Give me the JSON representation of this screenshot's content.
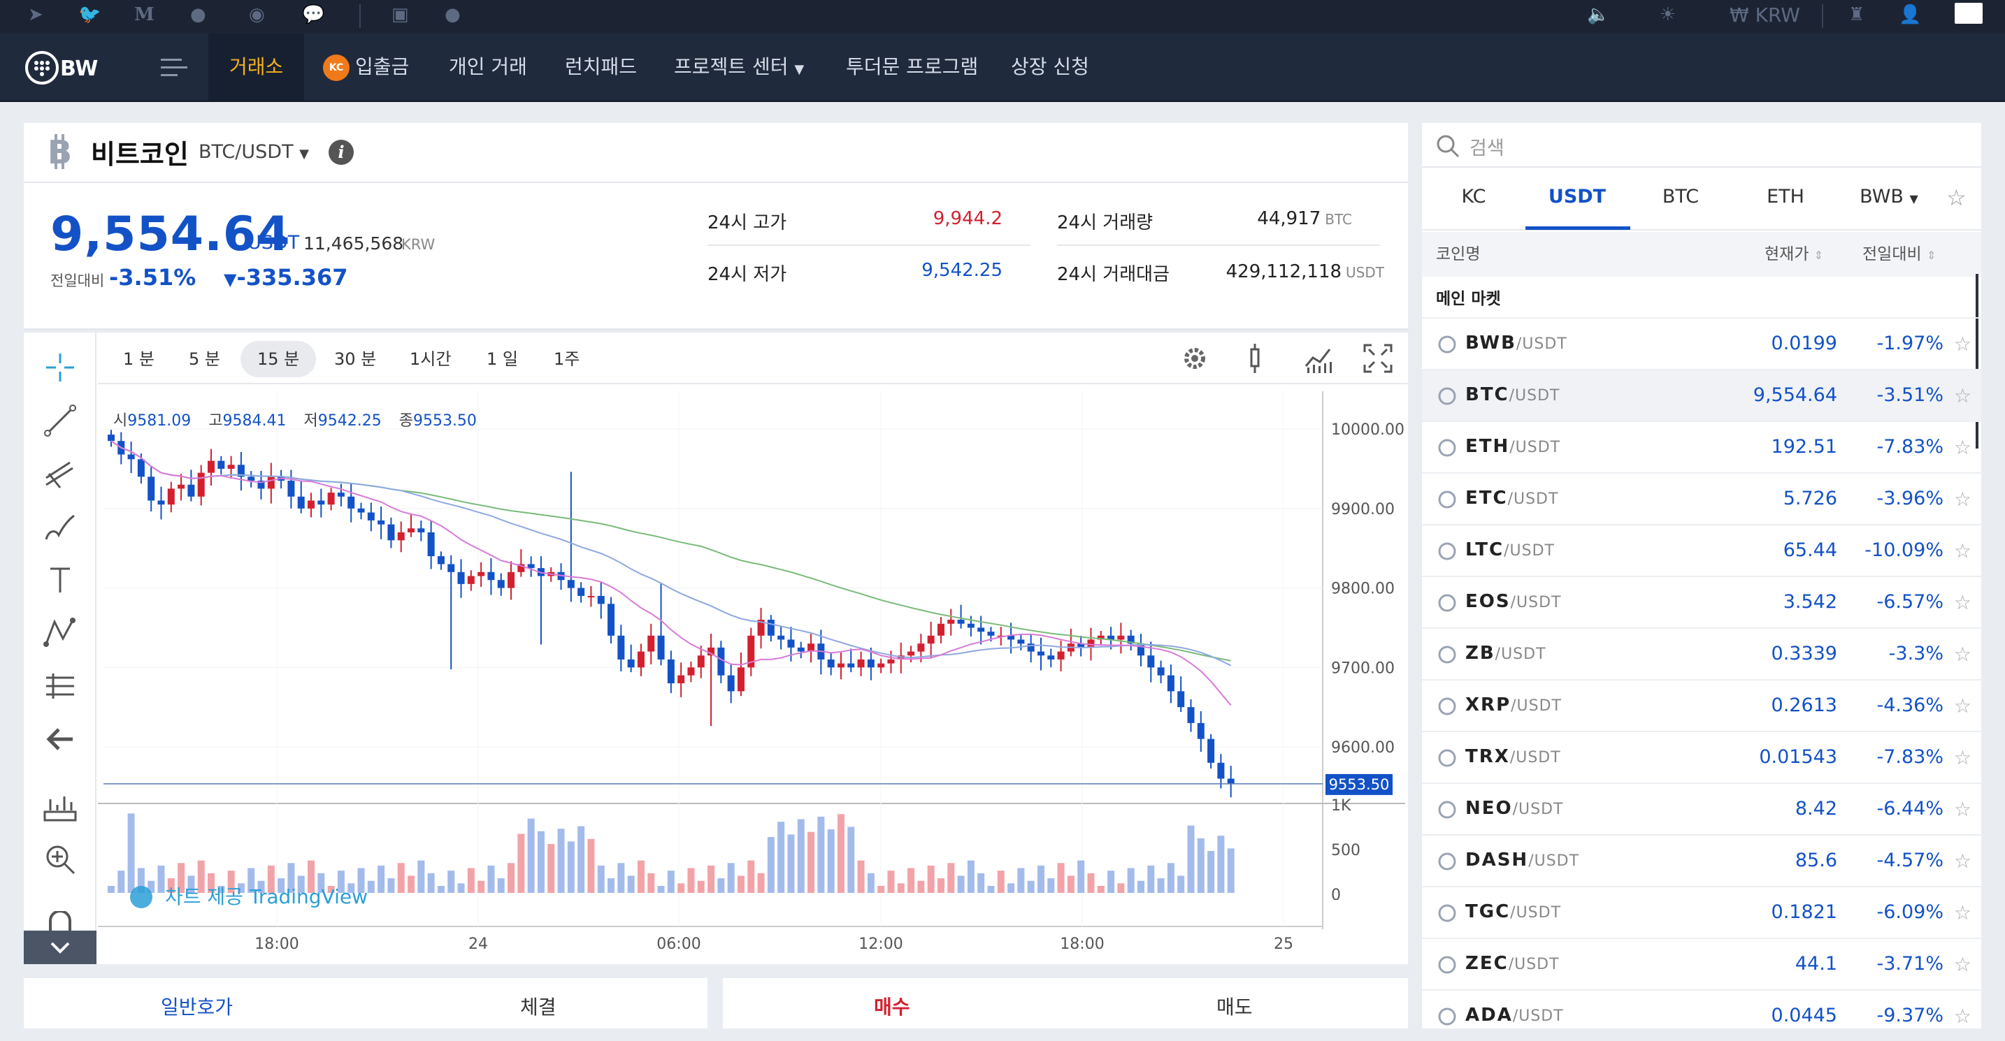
{
  "topbar": {
    "icons": [
      "telegram-icon",
      "twitter-icon",
      "medium-icon",
      "reddit-icon",
      "weibo-icon",
      "chat-icon",
      "android-icon",
      "apple-icon"
    ],
    "currency": "₩ KRW"
  },
  "nav": {
    "items": [
      {
        "label": "거래소",
        "active": true
      },
      {
        "label": "입출금",
        "badge": "KC"
      },
      {
        "label": "개인 거래"
      },
      {
        "label": "런치패드"
      },
      {
        "label": "프로젝트 센터"
      },
      {
        "label": "투더문 프로그램"
      },
      {
        "label": "상장 신청"
      }
    ]
  },
  "coin": {
    "name": "비트코인",
    "pair": "BTC/USDT"
  },
  "ticker": {
    "price": "9,554.64",
    "unit": "USDT",
    "krw": "11,465,568",
    "krw_unit": "KRW",
    "change_label": "전일대비",
    "change_pct": "-3.51%",
    "change_abs": "-335.367",
    "high_label": "24시 고가",
    "high": "9,944.2",
    "low_label": "24시 저가",
    "low": "9,542.25",
    "vol_label": "24시 거래량",
    "vol": "44,917",
    "vol_unit": "BTC",
    "amt_label": "24시 거래대금",
    "amt": "429,112,118",
    "amt_unit": "USDT"
  },
  "timeframes": [
    "1 분",
    "5 분",
    "15 분",
    "30 분",
    "1시간",
    "1 일",
    "1주"
  ],
  "active_timeframe": "15 분",
  "ohlc": {
    "o_label": "시",
    "o": "9581.09",
    "h_label": "고",
    "h": "9584.41",
    "l_label": "저",
    "l": "9542.25",
    "c_label": "종",
    "c": "9553.50"
  },
  "chart_data": {
    "type": "candlestick",
    "price_axis": [
      "10000.00",
      "9900.00",
      "9800.00",
      "9700.00",
      "9600.00"
    ],
    "volume_axis": [
      "1K",
      "500",
      "0"
    ],
    "time_axis": [
      "18:00",
      "24",
      "06:00",
      "12:00",
      "18:00",
      "25"
    ],
    "last_price": "9553.50",
    "watermark": "차트 제공 TradingView",
    "colors": {
      "up": "#d3202f",
      "down": "#1352c6",
      "ma1": "#7aba7a",
      "ma2": "#8fa8e0",
      "ma3": "#d87ad8"
    },
    "closes": [
      9985,
      9968,
      9962,
      9940,
      9910,
      9905,
      9925,
      9930,
      9915,
      9945,
      9960,
      9950,
      9955,
      9940,
      9935,
      9925,
      9940,
      9935,
      9915,
      9900,
      9910,
      9905,
      9920,
      9915,
      9900,
      9895,
      9885,
      9880,
      9860,
      9870,
      9875,
      9870,
      9840,
      9830,
      9820,
      9805,
      9815,
      9820,
      9810,
      9800,
      9820,
      9830,
      9825,
      9815,
      9820,
      9810,
      9800,
      9790,
      9790,
      9780,
      9740,
      9710,
      9700,
      9720,
      9740,
      9710,
      9680,
      9690,
      9700,
      9715,
      9725,
      9690,
      9670,
      9700,
      9740,
      9760,
      9740,
      9735,
      9725,
      9720,
      9730,
      9710,
      9700,
      9705,
      9700,
      9710,
      9700,
      9705,
      9710,
      9715,
      9720,
      9730,
      9740,
      9755,
      9760,
      9755,
      9750,
      9745,
      9740,
      9740,
      9735,
      9730,
      9720,
      9715,
      9710,
      9720,
      9730,
      9725,
      9735,
      9740,
      9735,
      9740,
      9730,
      9715,
      9700,
      9690,
      9670,
      9650,
      9630,
      9610,
      9580,
      9560,
      9554
    ]
  },
  "market": {
    "search_placeholder": "검색",
    "tabs": [
      "KC",
      "USDT",
      "BTC",
      "ETH",
      "BWB"
    ],
    "active_tab": "USDT",
    "col_name": "코인명",
    "col_price": "현재가",
    "col_change": "전일대비",
    "group": "메인 마켓",
    "rows": [
      {
        "sym": "BWB",
        "quote": "/USDT",
        "price": "0.0199",
        "chg": "-1.97%",
        "icon": "bwb-icon"
      },
      {
        "sym": "BTC",
        "quote": "/USDT",
        "price": "9,554.64",
        "chg": "-3.51%",
        "icon": "btc-icon"
      },
      {
        "sym": "ETH",
        "quote": "/USDT",
        "price": "192.51",
        "chg": "-7.83%",
        "icon": "eth-icon"
      },
      {
        "sym": "ETC",
        "quote": "/USDT",
        "price": "5.726",
        "chg": "-3.96%",
        "icon": "etc-icon"
      },
      {
        "sym": "LTC",
        "quote": "/USDT",
        "price": "65.44",
        "chg": "-10.09%",
        "icon": "ltc-icon"
      },
      {
        "sym": "EOS",
        "quote": "/USDT",
        "price": "3.542",
        "chg": "-6.57%",
        "icon": "eos-icon"
      },
      {
        "sym": "ZB",
        "quote": "/USDT",
        "price": "0.3339",
        "chg": "-3.3%",
        "icon": "zb-icon"
      },
      {
        "sym": "XRP",
        "quote": "/USDT",
        "price": "0.2613",
        "chg": "-4.36%",
        "icon": "xrp-icon"
      },
      {
        "sym": "TRX",
        "quote": "/USDT",
        "price": "0.01543",
        "chg": "-7.83%",
        "icon": "trx-icon"
      },
      {
        "sym": "NEO",
        "quote": "/USDT",
        "price": "8.42",
        "chg": "-6.44%",
        "icon": "neo-icon"
      },
      {
        "sym": "DASH",
        "quote": "/USDT",
        "price": "85.6",
        "chg": "-4.57%",
        "icon": "dash-icon"
      },
      {
        "sym": "TGC",
        "quote": "/USDT",
        "price": "0.1821",
        "chg": "-6.09%",
        "icon": "tgc-icon"
      },
      {
        "sym": "ZEC",
        "quote": "/USDT",
        "price": "44.1",
        "chg": "-3.71%",
        "icon": "zec-icon"
      },
      {
        "sym": "ADA",
        "quote": "/USDT",
        "price": "0.0445",
        "chg": "-9.37%",
        "icon": "ada-icon"
      }
    ]
  },
  "orderbook_tabs": [
    "일반호가",
    "체결"
  ],
  "trade_tabs": [
    "매수",
    "매도"
  ]
}
